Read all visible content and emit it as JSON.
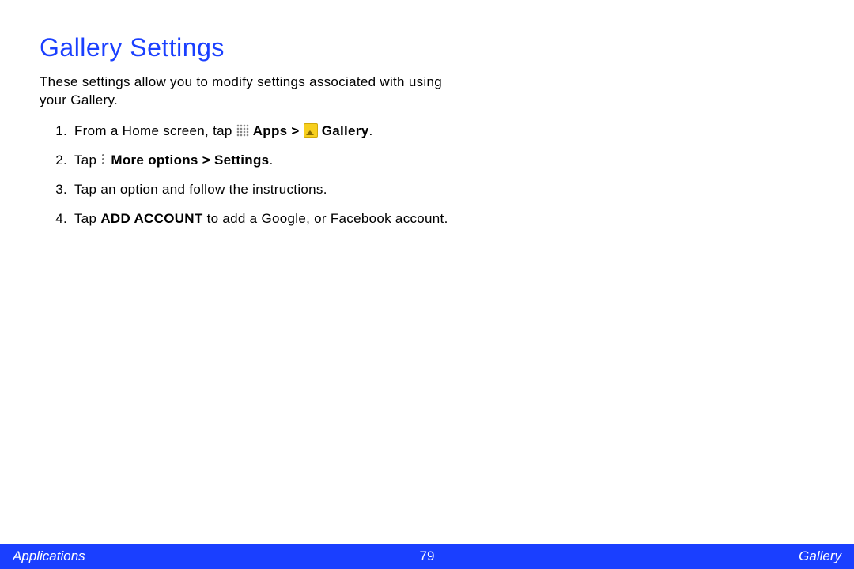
{
  "title": "Gallery Settings",
  "intro": "These settings allow you to modify settings associated with using your Gallery.",
  "steps": {
    "s1_pre": "From a Home screen, tap ",
    "s1_apps": "Apps",
    "s1_gt": " > ",
    "s1_gallery": "Gallery",
    "s1_post": ".",
    "s2_pre": "Tap ",
    "s2_bold": "More options > Settings",
    "s2_post": ".",
    "s3": "Tap an option and follow the instructions.",
    "s4_pre": "Tap ",
    "s4_bold": "ADD ACCOUNT",
    "s4_post": " to add a Google, or Facebook account."
  },
  "footer": {
    "left": "Applications",
    "page": "79",
    "right": "Gallery"
  }
}
